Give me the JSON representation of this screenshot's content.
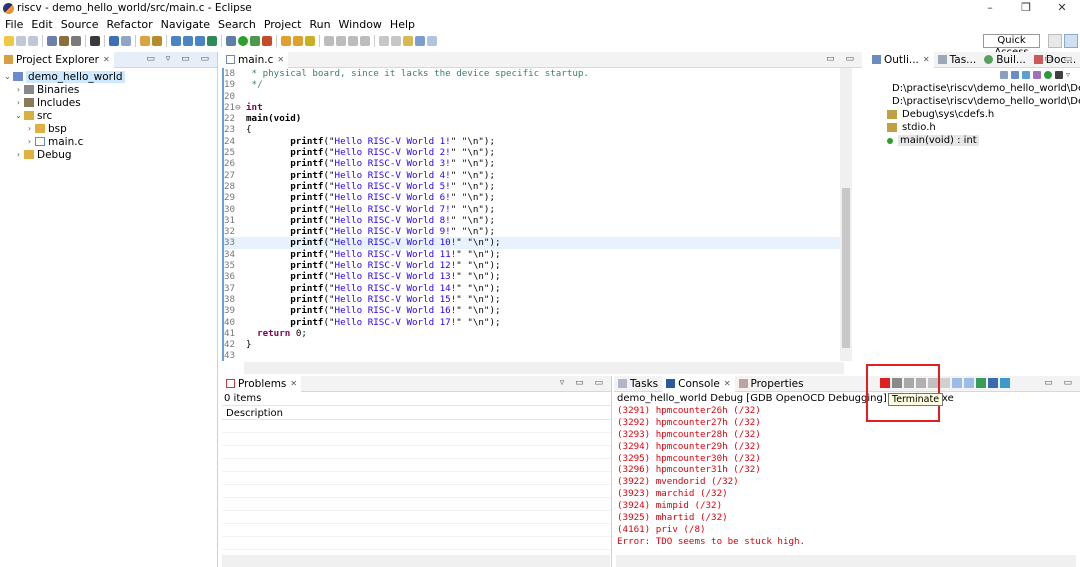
{
  "window": {
    "title": "riscv - demo_hello_world/src/main.c - Eclipse",
    "controls": [
      "–",
      "❐",
      "✕"
    ]
  },
  "menu": [
    "File",
    "Edit",
    "Source",
    "Refactor",
    "Navigate",
    "Search",
    "Project",
    "Run",
    "Window",
    "Help"
  ],
  "toolbar": {
    "quick_access": "Quick Access"
  },
  "explorer": {
    "tab": "Project Explorer",
    "tree": [
      {
        "label": "demo_hello_world",
        "arrow": "⌄",
        "indent": 0,
        "icon": "project-icon",
        "selected": true
      },
      {
        "label": "Binaries",
        "arrow": "›",
        "indent": 1,
        "icon": "binaries-icon"
      },
      {
        "label": "Includes",
        "arrow": "›",
        "indent": 1,
        "icon": "includes-icon"
      },
      {
        "label": "src",
        "arrow": "⌄",
        "indent": 1,
        "icon": "source-folder-icon"
      },
      {
        "label": "bsp",
        "arrow": "›",
        "indent": 2,
        "icon": "folder-icon"
      },
      {
        "label": "main.c",
        "arrow": "›",
        "indent": 2,
        "icon": "c-file-icon"
      },
      {
        "label": "Debug",
        "arrow": "›",
        "indent": 1,
        "icon": "folder-icon"
      }
    ]
  },
  "editor": {
    "tab": "main.c",
    "lines": [
      {
        "n": "18",
        "t": " * physical board, since it lacks the device specific startup.",
        "c": "cmt"
      },
      {
        "n": "19",
        "t": " */",
        "c": "cmt"
      },
      {
        "n": "20",
        "t": "",
        "c": ""
      },
      {
        "n": "21⊖",
        "t": "int",
        "c": "kw"
      },
      {
        "n": "22",
        "t": "main(void)",
        "c": "fn"
      },
      {
        "n": "23",
        "t": "{",
        "c": ""
      },
      {
        "n": "24",
        "p": "Hello RISC-V World 1!"
      },
      {
        "n": "25",
        "p": "Hello RISC-V World 2!"
      },
      {
        "n": "26",
        "p": "Hello RISC-V World 3!"
      },
      {
        "n": "27",
        "p": "Hello RISC-V World 4!"
      },
      {
        "n": "28",
        "p": "Hello RISC-V World 5!"
      },
      {
        "n": "29",
        "p": "Hello RISC-V World 6!"
      },
      {
        "n": "30",
        "p": "Hello RISC-V World 7!"
      },
      {
        "n": "31",
        "p": "Hello RISC-V World 8!"
      },
      {
        "n": "32",
        "p": "Hello RISC-V World 9!"
      },
      {
        "n": "33",
        "p": "Hello RISC-V World 10!",
        "cur": true
      },
      {
        "n": "34",
        "p": "Hello RISC-V World 11!"
      },
      {
        "n": "35",
        "p": "Hello RISC-V World 12!"
      },
      {
        "n": "36",
        "p": "Hello RISC-V World 13!"
      },
      {
        "n": "37",
        "p": "Hello RISC-V World 14!"
      },
      {
        "n": "38",
        "p": "Hello RISC-V World 15!"
      },
      {
        "n": "39",
        "p": "Hello RISC-V World 16!"
      },
      {
        "n": "40",
        "p": "Hello RISC-V World 17!"
      },
      {
        "n": "41",
        "r": "0;"
      },
      {
        "n": "42",
        "t": "}",
        "c": ""
      },
      {
        "n": "43",
        "t": "",
        "c": ""
      }
    ]
  },
  "outline": {
    "tabs": [
      "Outli...",
      "Tas...",
      "Buil...",
      "Doc..."
    ],
    "items": [
      {
        "label": "D:\\practise\\riscv\\demo_hello_world\\Debug\\",
        "icon": "include-icon"
      },
      {
        "label": "D:\\practise\\riscv\\demo_hello_world\\Debug\\",
        "icon": "include-icon"
      },
      {
        "label": "Debug\\sys\\cdefs.h",
        "icon": "include-icon"
      },
      {
        "label": "stdio.h",
        "icon": "include-icon"
      },
      {
        "label": "main(void) : int",
        "icon": "function-icon",
        "sel": true
      }
    ]
  },
  "problems": {
    "tab": "Problems",
    "count": "0 items",
    "column": "Description"
  },
  "console": {
    "tabs": [
      "Tasks",
      "Console",
      "Properties"
    ],
    "title": "demo_hello_world Debug [GDB OpenOCD Debugging] openocd.exe",
    "lines": [
      "(3291) hpmcounter26h (/32)",
      "(3292) hpmcounter27h (/32)",
      "(3293) hpmcounter28h (/32)",
      "(3294) hpmcounter29h (/32)",
      "(3295) hpmcounter30h (/32)",
      "(3296) hpmcounter31h (/32)",
      "(3922) mvendorid (/32)",
      "(3923) marchid (/32)",
      "(3924) mimpid (/32)",
      "(3925) mhartid (/32)",
      "(4161) priv (/8)",
      "Error: TDO seems to be stuck high."
    ],
    "tooltip": "Terminate"
  }
}
